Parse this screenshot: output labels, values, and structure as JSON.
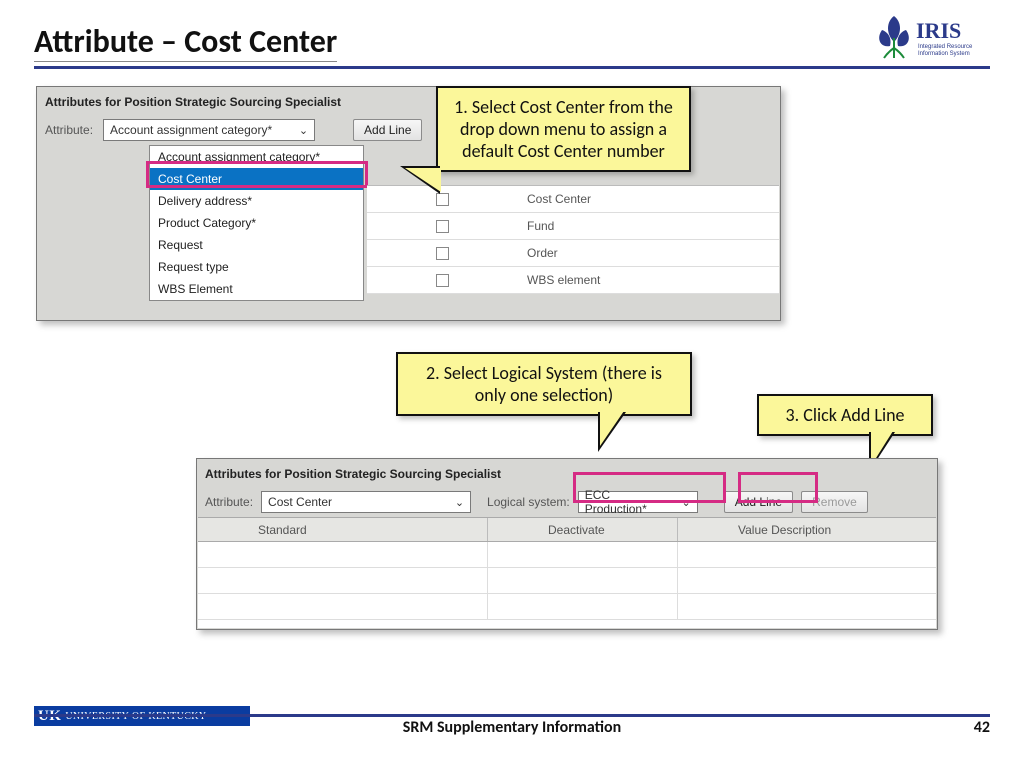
{
  "slide": {
    "title": "Attribute – Cost Center",
    "footer_title": "SRM Supplementary Information",
    "page_number": "42",
    "university": "UNIVERSITY OF KENTUCKY",
    "uk_prefix": "UK"
  },
  "iris": {
    "brand": "IRIS",
    "tagline1": "Integrated Resource",
    "tagline2": "Information System"
  },
  "panel1": {
    "header": "Attributes for Position Strategic Sourcing Specialist",
    "attr_label": "Attribute:",
    "select_value": "Account assignment category*",
    "add_line": "Add Line",
    "dropdown": [
      "Account assignment category*",
      "Cost Center",
      "Delivery address*",
      "Product Category*",
      "Request",
      "Request type",
      "WBS Element"
    ],
    "rows": [
      "Cost Center",
      "Fund",
      "Order",
      "WBS element"
    ]
  },
  "callouts": {
    "c1": "1. Select Cost Center from the drop down menu to assign a default Cost Center number",
    "c2": "2. Select Logical System (there is only one selection)",
    "c3": "3. Click Add Line"
  },
  "panel2": {
    "header": "Attributes for Position Strategic Sourcing Specialist",
    "attr_label": "Attribute:",
    "attr_value": "Cost Center",
    "logsys_label": "Logical system:",
    "logsys_value": "ECC Production*",
    "add_line": "Add Line",
    "remove": "Remove",
    "cols": [
      "Standard",
      "Deactivate",
      "Value Description"
    ]
  }
}
